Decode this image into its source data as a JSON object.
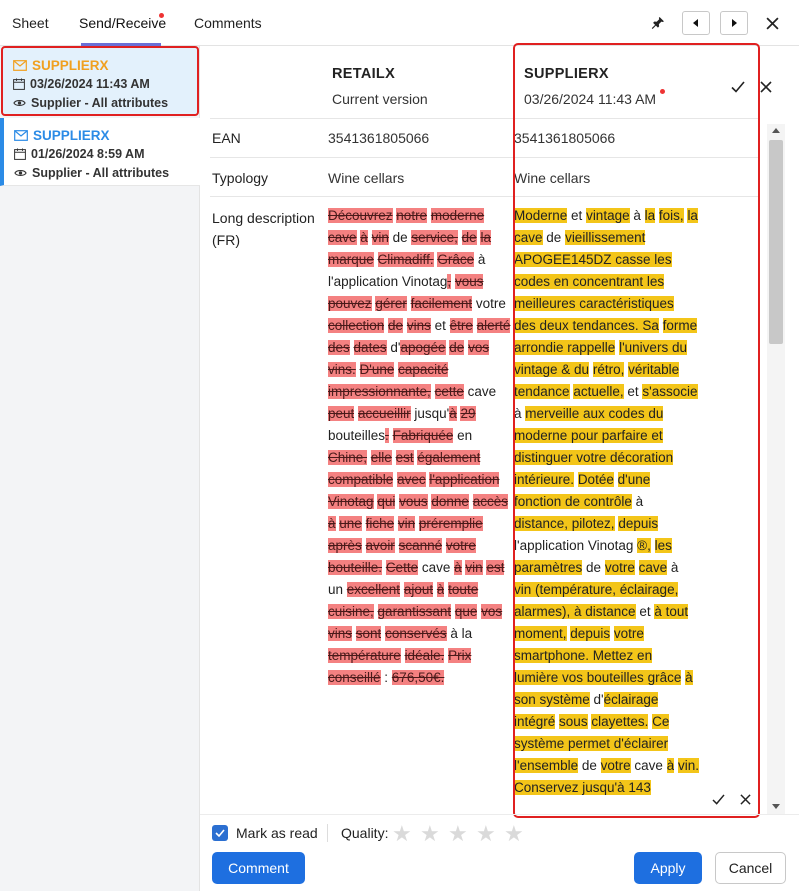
{
  "tabs": [
    {
      "label": "Sheet"
    },
    {
      "label": "Send/Receive"
    },
    {
      "label": "Comments"
    }
  ],
  "sidebar": {
    "cards": [
      {
        "title": "SUPPLIERX",
        "date": "03/26/2024 11:43 AM",
        "scope": "Supplier - All attributes",
        "title_color": "#f0a020"
      },
      {
        "title": "SUPPLIERX",
        "date": "01/26/2024 8:59 AM",
        "scope": "Supplier - All attributes",
        "title_color": "#2b8be6"
      }
    ]
  },
  "compare": {
    "left": {
      "title": "RETAILX",
      "subtitle": "Current version"
    },
    "right": {
      "title": "SUPPLIERX",
      "subtitle": "03/26/2024 11:43 AM"
    },
    "rows": [
      {
        "label": "EAN",
        "left": "3541361805066",
        "right": "3541361805066"
      },
      {
        "label": "Typology",
        "left": "Wine cellars",
        "right": "Wine cellars"
      },
      {
        "label": "Long description (FR)"
      }
    ]
  },
  "diff_left": [
    [
      "del",
      "Découvrez"
    ],
    [
      "keep",
      " "
    ],
    [
      "del",
      "notre"
    ],
    [
      "keep",
      " "
    ],
    [
      "del",
      "moderne"
    ],
    [
      "keep",
      " "
    ],
    [
      "del",
      "cave"
    ],
    [
      "keep",
      " "
    ],
    [
      "del",
      "à"
    ],
    [
      "keep",
      " "
    ],
    [
      "del",
      "vin"
    ],
    [
      "keep",
      " de "
    ],
    [
      "del",
      "service,"
    ],
    [
      "keep",
      " "
    ],
    [
      "del",
      "de"
    ],
    [
      "keep",
      " "
    ],
    [
      "del",
      "la"
    ],
    [
      "keep",
      " "
    ],
    [
      "del",
      "marque"
    ],
    [
      "keep",
      " "
    ],
    [
      "del",
      "Climadiff."
    ],
    [
      "keep",
      " "
    ],
    [
      "del",
      "Grâce"
    ],
    [
      "keep",
      " à "
    ],
    [
      "keep",
      "l'application Vinotag"
    ],
    [
      "del",
      ","
    ],
    [
      "keep",
      " "
    ],
    [
      "del",
      "vous"
    ],
    [
      "keep",
      " "
    ],
    [
      "del",
      "pouvez"
    ],
    [
      "keep",
      " "
    ],
    [
      "del",
      "gérer"
    ],
    [
      "keep",
      " "
    ],
    [
      "del",
      "facilement"
    ],
    [
      "keep",
      " "
    ],
    [
      "keep",
      "votre "
    ],
    [
      "del",
      "collection"
    ],
    [
      "keep",
      " "
    ],
    [
      "del",
      "de"
    ],
    [
      "keep",
      " "
    ],
    [
      "del",
      "vins"
    ],
    [
      "keep",
      " et "
    ],
    [
      "del",
      "être"
    ],
    [
      "keep",
      " "
    ],
    [
      "del",
      "alerté"
    ],
    [
      "keep",
      " "
    ],
    [
      "del",
      "des"
    ],
    [
      "keep",
      " "
    ],
    [
      "del",
      "dates"
    ],
    [
      "keep",
      " "
    ],
    [
      "keep",
      "d'"
    ],
    [
      "del",
      "apogée"
    ],
    [
      "keep",
      " "
    ],
    [
      "del",
      "de"
    ],
    [
      "keep",
      " "
    ],
    [
      "del",
      "vos"
    ],
    [
      "keep",
      " "
    ],
    [
      "del",
      "vins."
    ],
    [
      "keep",
      " "
    ],
    [
      "del",
      "D'une"
    ],
    [
      "keep",
      " "
    ],
    [
      "del",
      "capacité"
    ],
    [
      "keep",
      " "
    ],
    [
      "del",
      "impressionnante,"
    ],
    [
      "keep",
      " "
    ],
    [
      "del",
      "cette"
    ],
    [
      "keep",
      " cave "
    ],
    [
      "del",
      "peut"
    ],
    [
      "keep",
      " "
    ],
    [
      "del",
      "accueillir"
    ],
    [
      "keep",
      " "
    ],
    [
      "keep",
      "jusqu'"
    ],
    [
      "del",
      "à"
    ],
    [
      "keep",
      " "
    ],
    [
      "del",
      "29"
    ],
    [
      "keep",
      " bouteilles"
    ],
    [
      "del",
      "."
    ],
    [
      "keep",
      " "
    ],
    [
      "del",
      "Fabriquée"
    ],
    [
      "keep",
      " en "
    ],
    [
      "del",
      "Chine,"
    ],
    [
      "keep",
      " "
    ],
    [
      "del",
      "elle"
    ],
    [
      "keep",
      " "
    ],
    [
      "del",
      "est"
    ],
    [
      "keep",
      " "
    ],
    [
      "del",
      "également"
    ],
    [
      "keep",
      " "
    ],
    [
      "del",
      "compatible"
    ],
    [
      "keep",
      " "
    ],
    [
      "del",
      "avec"
    ],
    [
      "keep",
      " "
    ],
    [
      "del",
      "l'application"
    ],
    [
      "keep",
      " "
    ],
    [
      "del",
      "Vinotag"
    ],
    [
      "keep",
      " "
    ],
    [
      "del",
      "qui"
    ],
    [
      "keep",
      " "
    ],
    [
      "del",
      "vous"
    ],
    [
      "keep",
      " "
    ],
    [
      "del",
      "donne"
    ],
    [
      "keep",
      " "
    ],
    [
      "del",
      "accès"
    ],
    [
      "keep",
      " "
    ],
    [
      "del",
      "à"
    ],
    [
      "keep",
      " "
    ],
    [
      "del",
      "une"
    ],
    [
      "keep",
      " "
    ],
    [
      "del",
      "fiche"
    ],
    [
      "keep",
      " "
    ],
    [
      "del",
      "vin"
    ],
    [
      "keep",
      " "
    ],
    [
      "del",
      "préremplie"
    ],
    [
      "keep",
      " "
    ],
    [
      "del",
      "après"
    ],
    [
      "keep",
      " "
    ],
    [
      "del",
      "avoir"
    ],
    [
      "keep",
      " "
    ],
    [
      "del",
      "scanné"
    ],
    [
      "keep",
      " "
    ],
    [
      "del",
      "votre"
    ],
    [
      "keep",
      " "
    ],
    [
      "del",
      "bouteille."
    ],
    [
      "keep",
      " "
    ],
    [
      "del",
      "Cette"
    ],
    [
      "keep",
      " "
    ],
    [
      "keep",
      "cave "
    ],
    [
      "del",
      "à"
    ],
    [
      "keep",
      " "
    ],
    [
      "del",
      "vin"
    ],
    [
      "keep",
      " "
    ],
    [
      "del",
      "est"
    ],
    [
      "keep",
      " un "
    ],
    [
      "del",
      "excellent"
    ],
    [
      "keep",
      " "
    ],
    [
      "del",
      "ajout"
    ],
    [
      "keep",
      " "
    ],
    [
      "del",
      "à"
    ],
    [
      "keep",
      " "
    ],
    [
      "del",
      "toute"
    ],
    [
      "keep",
      " "
    ],
    [
      "del",
      "cuisine,"
    ],
    [
      "keep",
      " "
    ],
    [
      "del",
      "garantissant"
    ],
    [
      "keep",
      " "
    ],
    [
      "del",
      "que"
    ],
    [
      "keep",
      " "
    ],
    [
      "del",
      "vos"
    ],
    [
      "keep",
      " "
    ],
    [
      "del",
      "vins"
    ],
    [
      "keep",
      " "
    ],
    [
      "del",
      "sont"
    ],
    [
      "keep",
      " "
    ],
    [
      "del",
      "conservés"
    ],
    [
      "keep",
      " à la "
    ],
    [
      "del",
      "température"
    ],
    [
      "keep",
      " "
    ],
    [
      "del",
      "idéale."
    ],
    [
      "keep",
      " "
    ],
    [
      "del",
      "Prix"
    ],
    [
      "keep",
      " "
    ],
    [
      "del",
      "conseillé"
    ],
    [
      "keep",
      " : "
    ],
    [
      "del",
      "676,50€."
    ]
  ],
  "diff_right": [
    [
      "ins",
      "Moderne"
    ],
    [
      "keep",
      " et "
    ],
    [
      "ins",
      "vintage"
    ],
    [
      "keep",
      " à "
    ],
    [
      "ins",
      "la"
    ],
    [
      "keep",
      " "
    ],
    [
      "ins",
      "fois,"
    ],
    [
      "keep",
      " "
    ],
    [
      "ins",
      "la cave"
    ],
    [
      "keep",
      " de "
    ],
    [
      "ins",
      "vieillissement"
    ],
    [
      "keep",
      " "
    ],
    [
      "ins",
      "APOGEE145DZ casse les"
    ],
    [
      "keep",
      " "
    ],
    [
      "ins",
      "codes en concentrant les"
    ],
    [
      "keep",
      " "
    ],
    [
      "ins",
      "meilleures caractéristiques"
    ],
    [
      "keep",
      " "
    ],
    [
      "ins",
      "des deux tendances. Sa"
    ],
    [
      "keep",
      " "
    ],
    [
      "ins",
      "forme arrondie rappelle"
    ],
    [
      "keep",
      " "
    ],
    [
      "ins",
      "l'univers du vintage & du"
    ],
    [
      "keep",
      " "
    ],
    [
      "ins",
      "rétro,"
    ],
    [
      "keep",
      " "
    ],
    [
      "ins",
      "véritable"
    ],
    [
      "keep",
      " "
    ],
    [
      "ins",
      "tendance"
    ],
    [
      "keep",
      " "
    ],
    [
      "ins",
      "actuelle,"
    ],
    [
      "keep",
      " et "
    ],
    [
      "ins",
      "s'associe"
    ],
    [
      "keep",
      " à "
    ],
    [
      "ins",
      "merveille aux codes du"
    ],
    [
      "keep",
      " "
    ],
    [
      "ins",
      "moderne pour parfaire et"
    ],
    [
      "keep",
      " "
    ],
    [
      "ins",
      "distinguer votre décoration"
    ],
    [
      "keep",
      " "
    ],
    [
      "ins",
      "intérieure."
    ],
    [
      "keep",
      " "
    ],
    [
      "ins",
      "Dotée"
    ],
    [
      "keep",
      " "
    ],
    [
      "ins",
      "d'une"
    ],
    [
      "keep",
      " "
    ],
    [
      "ins",
      "fonction de contrôle"
    ],
    [
      "keep",
      " à "
    ],
    [
      "ins",
      "distance, pilotez,"
    ],
    [
      "keep",
      " "
    ],
    [
      "ins",
      "depuis"
    ],
    [
      "keep",
      " "
    ],
    [
      "keep",
      "l'application Vinotag "
    ],
    [
      "ins",
      "®,"
    ],
    [
      "keep",
      " "
    ],
    [
      "ins",
      "les"
    ],
    [
      "keep",
      " "
    ],
    [
      "ins",
      "paramètres"
    ],
    [
      "keep",
      " de "
    ],
    [
      "ins",
      "votre"
    ],
    [
      "keep",
      " "
    ],
    [
      "ins",
      "cave"
    ],
    [
      "keep",
      " à "
    ],
    [
      "ins",
      "vin (température, éclairage,"
    ],
    [
      "keep",
      " "
    ],
    [
      "ins",
      "alarmes), à distance"
    ],
    [
      "keep",
      " et "
    ],
    [
      "ins",
      "à tout"
    ],
    [
      "keep",
      " "
    ],
    [
      "ins",
      "moment,"
    ],
    [
      "keep",
      " "
    ],
    [
      "ins",
      "depuis"
    ],
    [
      "keep",
      " "
    ],
    [
      "ins",
      "votre"
    ],
    [
      "keep",
      " "
    ],
    [
      "ins",
      "smartphone. Mettez en"
    ],
    [
      "keep",
      " "
    ],
    [
      "ins",
      "lumière vos bouteilles grâce"
    ],
    [
      "keep",
      " "
    ],
    [
      "ins",
      "à son système"
    ],
    [
      "keep",
      " d'"
    ],
    [
      "ins",
      "éclairage"
    ],
    [
      "keep",
      " "
    ],
    [
      "ins",
      "intégré"
    ],
    [
      "keep",
      " "
    ],
    [
      "ins",
      "sous"
    ],
    [
      "keep",
      " "
    ],
    [
      "ins",
      "clayettes."
    ],
    [
      "keep",
      " "
    ],
    [
      "ins",
      "Ce"
    ],
    [
      "keep",
      " "
    ],
    [
      "ins",
      "système permet d'éclairer"
    ],
    [
      "keep",
      " "
    ],
    [
      "ins",
      "l'ensemble"
    ],
    [
      "keep",
      " de "
    ],
    [
      "ins",
      "votre"
    ],
    [
      "keep",
      " cave "
    ],
    [
      "ins",
      "à"
    ],
    [
      "keep",
      " "
    ],
    [
      "ins",
      "vin. Conservez jusqu'à 143"
    ]
  ],
  "footer": {
    "mark_as_read": "Mark as read",
    "quality_label": "Quality:",
    "quality_value": 0,
    "quality_max": 5,
    "comment_btn": "Comment",
    "apply_btn": "Apply",
    "cancel_btn": "Cancel"
  },
  "colors": {
    "accent": "#1e6fe0",
    "deleted": "#f48181",
    "inserted": "#f3c519",
    "highlight": "#e02020"
  }
}
